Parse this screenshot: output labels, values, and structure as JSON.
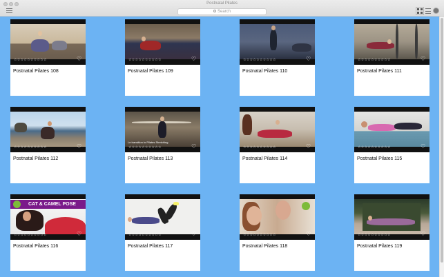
{
  "window": {
    "title": "Postnatal Pilates"
  },
  "toolbar": {
    "search_placeholder": "Search"
  },
  "videos": [
    {
      "title": "Postnatal Pilates 108",
      "rating": "☆☆☆☆☆☆☆☆☆☆"
    },
    {
      "title": "Postnatal Pilates 109",
      "rating": "☆☆☆☆☆☆☆☆☆☆"
    },
    {
      "title": "Postnatal Pilates 110",
      "rating": "☆☆☆☆☆☆☆☆☆☆"
    },
    {
      "title": "Postnatal Pilates 111",
      "rating": "☆☆☆☆☆☆☆☆☆☆"
    },
    {
      "title": "Postnatal Pilates 112",
      "rating": "☆☆☆☆☆☆☆☆☆☆"
    },
    {
      "title": "Postnatal Pilates 113",
      "rating": "☆☆☆☆☆☆☆☆☆☆",
      "overlay_text": "Le transition to Pilates Stretching"
    },
    {
      "title": "Postnatal Pilates 114",
      "rating": "☆☆☆☆☆☆☆☆☆☆"
    },
    {
      "title": "Postnatal Pilates 115",
      "rating": "☆☆☆☆☆☆☆☆☆☆"
    },
    {
      "title": "Postnatal Pilates 116",
      "rating": "☆☆☆☆☆☆☆☆☆☆",
      "overlay_text": "CAT & CAMEL POSE"
    },
    {
      "title": "Postnatal Pilates 117",
      "rating": "☆☆☆☆☆☆☆☆☆☆"
    },
    {
      "title": "Postnatal Pilates 118",
      "rating": "☆☆☆☆☆☆☆☆☆☆"
    },
    {
      "title": "Postnatal Pilates 119",
      "rating": "☆☆☆☆☆☆☆☆☆☆"
    }
  ],
  "colors": {
    "background": "#6cb3f3",
    "card": "#ffffff",
    "thumbnail_letterbox": "#111111",
    "banner_purple": "#7a1a8a"
  },
  "icons": [
    "menu-icon",
    "search-icon",
    "grid-view-icon",
    "list-view-icon",
    "settings-icon",
    "heart-icon"
  ]
}
